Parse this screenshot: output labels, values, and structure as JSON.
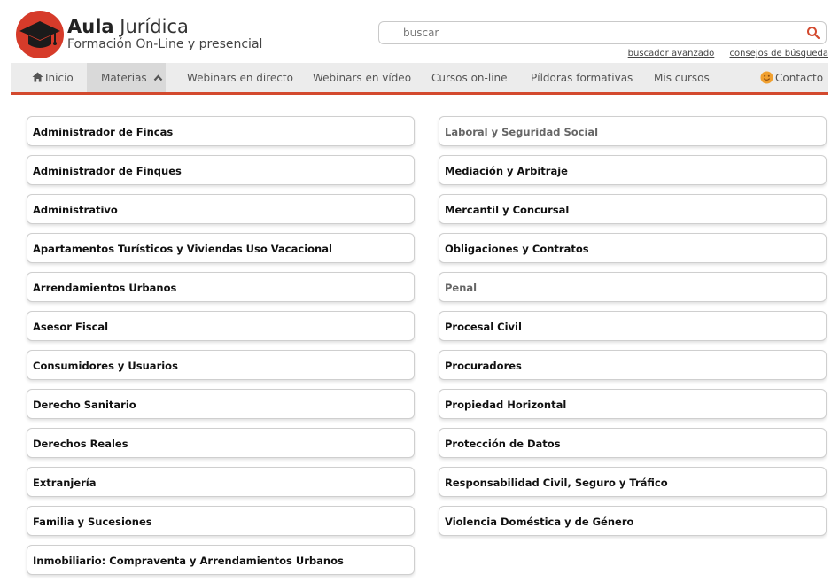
{
  "brand": {
    "name_bold": "Aula",
    "name_rest": "Jurídica",
    "subtitle": "Formación On-Line y presencial"
  },
  "search": {
    "placeholder": "buscar",
    "value": "",
    "links": [
      "buscador avanzado",
      "consejos de búsqueda"
    ]
  },
  "nav": {
    "items": [
      {
        "label": "Inicio",
        "icon": "home-icon"
      },
      {
        "label": "Materias",
        "icon": "chevron-up-icon",
        "active": true
      },
      {
        "label": "Webinars en directo"
      },
      {
        "label": "Webinars en vídeo"
      },
      {
        "label": "Cursos on-line"
      },
      {
        "label": "Píldoras formativas"
      },
      {
        "label": "Mis cursos"
      },
      {
        "label": "Contacto",
        "icon": "smiley-icon"
      }
    ]
  },
  "materias": {
    "left": [
      "Administrador de Fincas",
      "Administrador de Finques",
      "Administrativo",
      "Apartamentos Turísticos y Viviendas Uso Vacacional",
      "Arrendamientos Urbanos",
      "Asesor Fiscal",
      "Consumidores y Usuarios",
      "Derecho Sanitario",
      "Derechos Reales",
      "Extranjería",
      "Familia y Sucesiones",
      "Inmobiliario: Compraventa y Arrendamientos Urbanos"
    ],
    "right": [
      "Laboral y Seguridad Social",
      "Mediación y Arbitraje",
      "Mercantil y Concursal",
      "Obligaciones y Contratos",
      "Penal",
      "Procesal Civil",
      "Procuradores",
      "Propiedad Horizontal",
      "Protección de Datos",
      "Responsabilidad Civil, Seguro y Tráfico",
      "Violencia Doméstica y de Género"
    ]
  },
  "colors": {
    "accent": "#d3492e",
    "logo": "#d63b2a",
    "nav_bg": "#ececec"
  }
}
